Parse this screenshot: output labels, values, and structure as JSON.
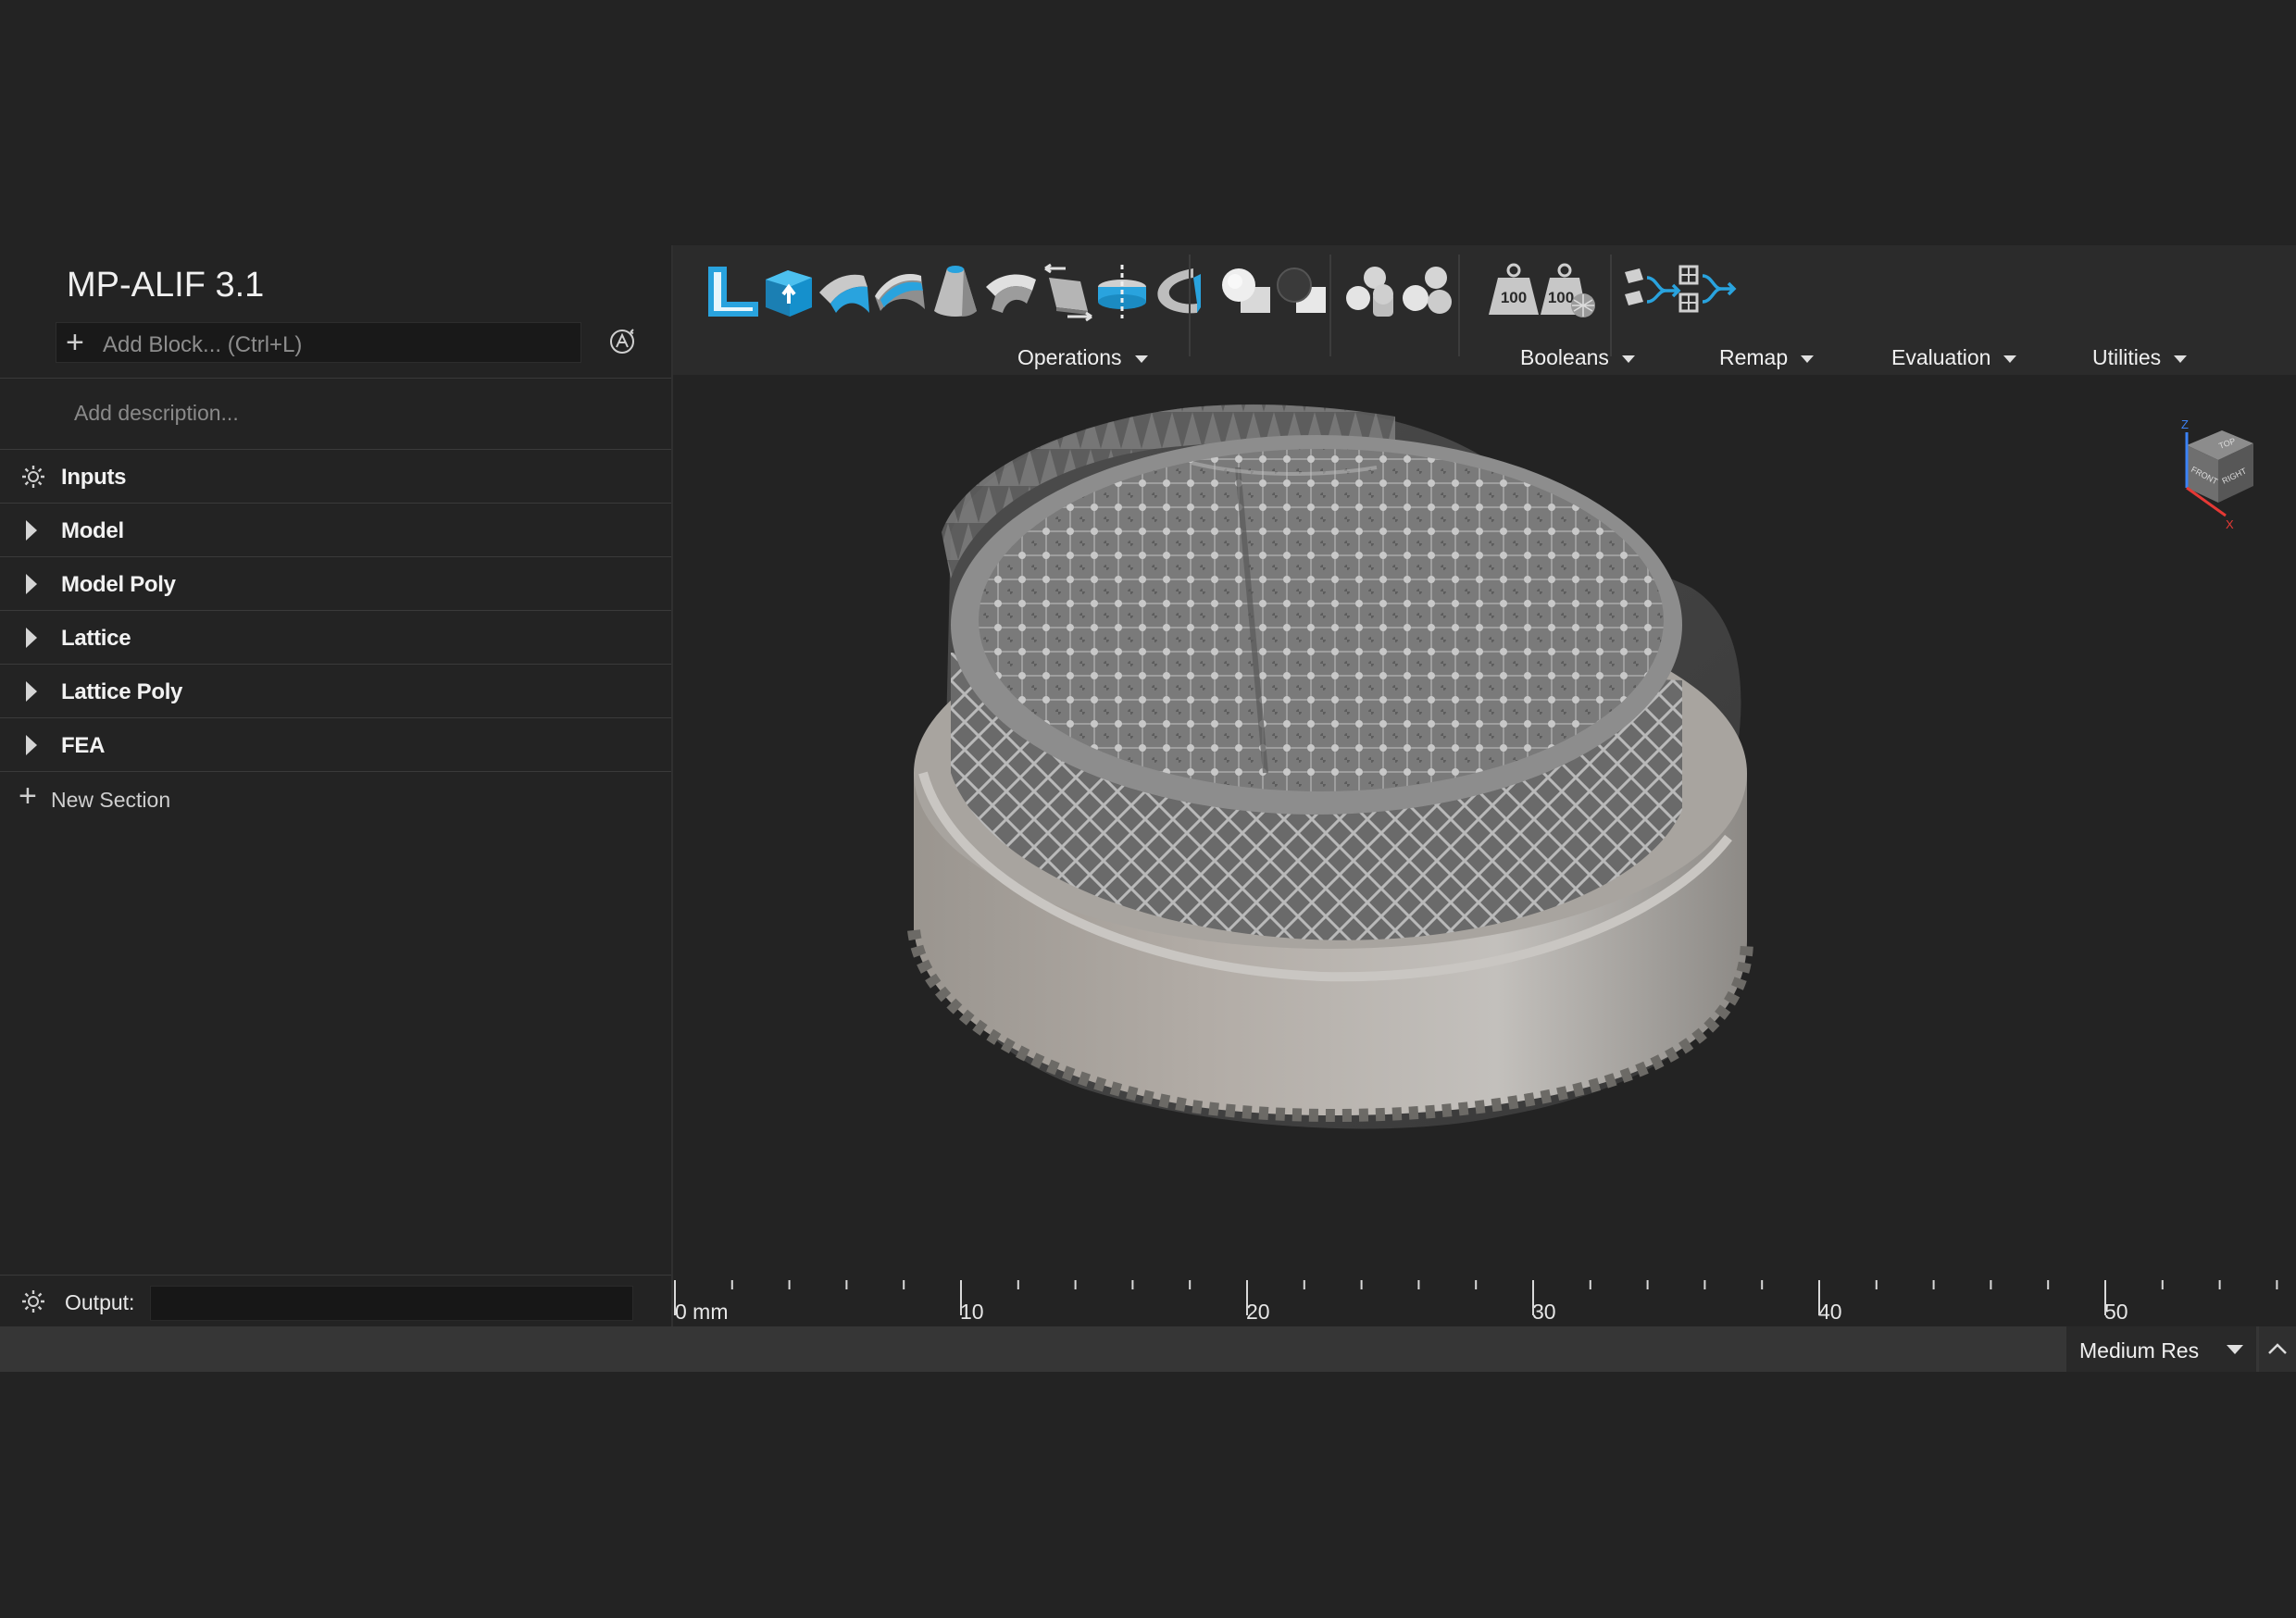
{
  "document": {
    "title": "MP-ALIF 3.1"
  },
  "left_panel": {
    "add_block_placeholder": "Add Block... (Ctrl+L)",
    "description_placeholder": "Add description...",
    "sections": [
      {
        "label": "Inputs",
        "icon": "gear-icon"
      },
      {
        "label": "Model",
        "icon": "expand-arrow-icon"
      },
      {
        "label": "Model Poly",
        "icon": "expand-arrow-icon"
      },
      {
        "label": "Lattice",
        "icon": "expand-arrow-icon"
      },
      {
        "label": "Lattice Poly",
        "icon": "expand-arrow-icon"
      },
      {
        "label": "FEA",
        "icon": "expand-arrow-icon"
      }
    ],
    "new_section_label": "New Section",
    "output_label": "Output:",
    "output_value": ""
  },
  "toolbar": {
    "groups": [
      {
        "label": "Operations"
      },
      {
        "label": "Booleans"
      },
      {
        "label": "Remap"
      },
      {
        "label": "Evaluation"
      },
      {
        "label": "Utilities"
      }
    ],
    "evaluation_icon_text": "100",
    "colors": {
      "accent": "#29a3de",
      "tool_gray": "#9a9a9a"
    }
  },
  "viewport": {
    "nav_cube": {
      "top": "TOP",
      "front": "FRONT",
      "right": "RIGHT",
      "z_axis": "Z",
      "x_axis": "X"
    },
    "ruler": {
      "unit_label": "0 mm",
      "major_labels": [
        "10",
        "20",
        "30",
        "40",
        "50"
      ]
    }
  },
  "status_bar": {
    "resolution": "Medium Res"
  }
}
